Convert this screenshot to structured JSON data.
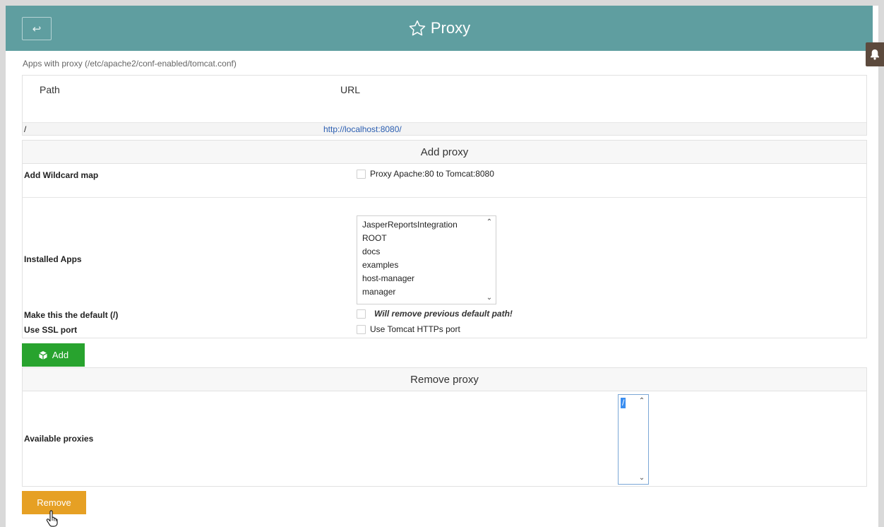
{
  "header": {
    "back_icon": "↩",
    "title": "Proxy"
  },
  "proxy_list": {
    "note": "Apps with proxy (/etc/apache2/conf-enabled/tomcat.conf)",
    "col_path": "Path",
    "col_url": "URL",
    "rows": [
      {
        "path": "/",
        "url": "http://localhost:8080/"
      }
    ]
  },
  "add_section": {
    "title": "Add proxy",
    "wildcard_label": "Add Wildcard map",
    "wildcard_cb": "Proxy Apache:80 to Tomcat:8080",
    "installed_label": "Installed Apps",
    "installed_options": [
      "JasperReportsIntegration",
      "ROOT",
      "docs",
      "examples",
      "host-manager",
      "manager"
    ],
    "default_label": "Make this the default (/)",
    "default_warn": "Will remove previous default path!",
    "ssl_label": "Use SSL port",
    "ssl_cb": "Use Tomcat HTTPs port",
    "add_button": "Add"
  },
  "remove_section": {
    "title": "Remove proxy",
    "available_label": "Available proxies",
    "available_options": [
      "/"
    ],
    "remove_button": "Remove"
  },
  "colors": {
    "header": "#5f9ea0",
    "add_button": "#28a32e",
    "remove_button": "#e6a024",
    "link": "#2a5db0"
  },
  "icons": {
    "title": "star-icon",
    "back": "back-arrow-icon",
    "notification": "bell-icon",
    "add": "cube-icon",
    "cursor": "hand-pointer-icon"
  }
}
